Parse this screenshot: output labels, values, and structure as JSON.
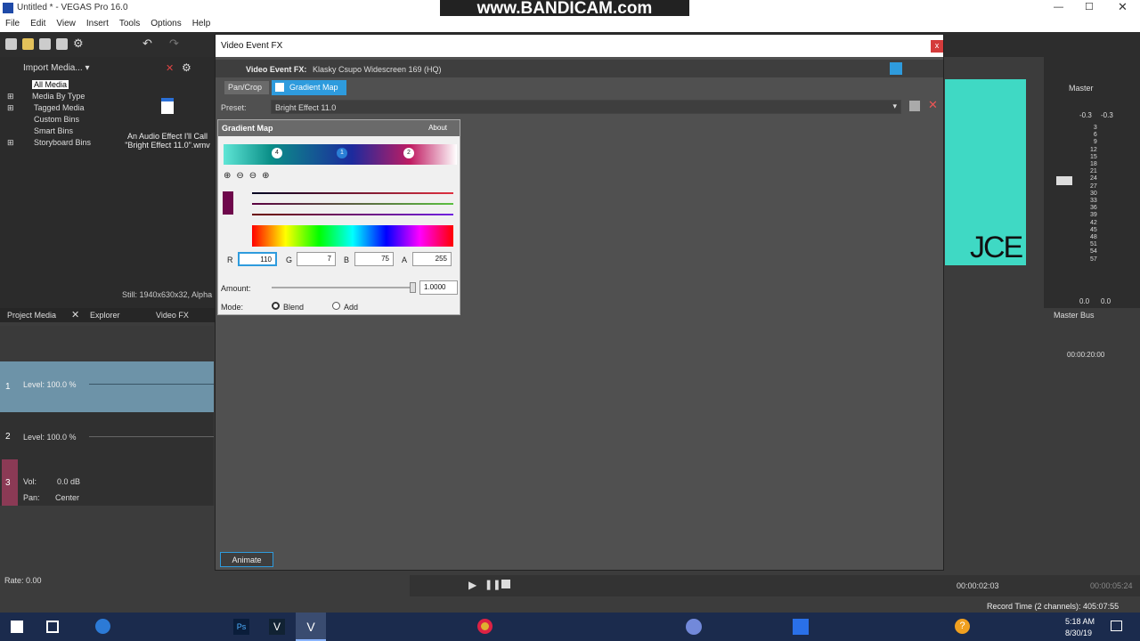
{
  "window": {
    "title": "Untitled * - VEGAS Pro 16.0",
    "watermark": "www.BANDICAM.com"
  },
  "menu": [
    "File",
    "Edit",
    "View",
    "Insert",
    "Tools",
    "Options",
    "Help"
  ],
  "explorer": {
    "import_label": "Import Media...",
    "tree": [
      "All Media",
      "Media By Type",
      "Tagged Media",
      "Custom Bins",
      "Smart Bins",
      "Storyboard Bins"
    ],
    "file_name": "An Audio Effect I'll Call \"Bright Effect 11.0\".wmv",
    "status": "Still: 1940x630x32, Alpha"
  },
  "tabs": {
    "project_media": "Project Media",
    "explorer": "Explorer",
    "video_fx": "Video FX",
    "master_bus": "Master Bus"
  },
  "dialog": {
    "title": "Video Event FX",
    "fx_label": "Video Event FX:",
    "fx_name": "Klasky Csupo Widescreen 169 (HQ)",
    "chain": [
      "Pan/Crop",
      "Gradient Map"
    ],
    "preset_label": "Preset:",
    "preset_value": "Bright Effect 11.0",
    "animate": "Animate"
  },
  "gradient_map": {
    "title": "Gradient Map",
    "about": "About",
    "r_label": "R",
    "r": "110",
    "g_label": "G",
    "g": "7",
    "b_label": "B",
    "b": "75",
    "a_label": "A",
    "a": "255",
    "amount_label": "Amount:",
    "amount": "1.0000",
    "mode_label": "Mode:",
    "mode_blend": "Blend",
    "mode_add": "Add",
    "stops": [
      "4",
      "1",
      "2"
    ]
  },
  "master": {
    "label": "Master",
    "levels": [
      "-0.3",
      "-0.3"
    ],
    "scale": [
      "3",
      "6",
      "9",
      "12",
      "15",
      "18",
      "21",
      "24",
      "27",
      "30",
      "33",
      "36",
      "39",
      "42",
      "45",
      "48",
      "51",
      "54",
      "57"
    ],
    "bottom": [
      "0.0",
      "0.0"
    ]
  },
  "tracks": [
    {
      "num": "1",
      "level": "Level: 100.0 %"
    },
    {
      "num": "2",
      "level": "Level: 100.0 %"
    },
    {
      "num": "3",
      "vol_label": "Vol:",
      "vol": "0.0 dB",
      "pan_label": "Pan:",
      "pan": "Center"
    }
  ],
  "timeline": {
    "rate": "Rate: 0.00",
    "time": "00:00:02:03",
    "time2": "00:00:05:24",
    "ruler": "00:00:20:00",
    "record": "Record Time (2 channels): 405:07:55"
  },
  "clock": {
    "time": "5:18 AM",
    "date": "8/30/19"
  },
  "preview_text": "JCE",
  "colors": {
    "accent": "#2e9bdd",
    "teal": "#39d6c0"
  }
}
